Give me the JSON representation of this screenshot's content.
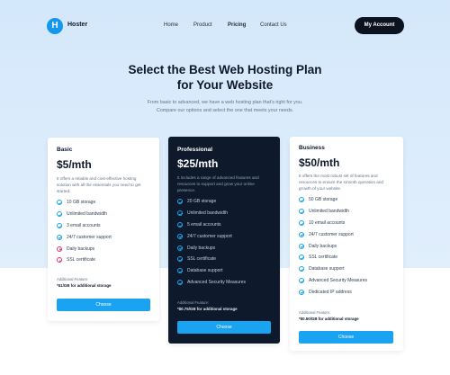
{
  "brand": {
    "logo_letter": "H",
    "name": "Hoster"
  },
  "nav": {
    "links": [
      {
        "label": "Home",
        "active": false
      },
      {
        "label": "Product",
        "active": false
      },
      {
        "label": "Pricing",
        "active": true
      },
      {
        "label": "Contact Us",
        "active": false
      }
    ],
    "account_button": "My Account"
  },
  "hero": {
    "title_line1": "Select the Best Web Hosting Plan",
    "title_line2": "for Your Website",
    "subtitle_line1": "From basic to advanced, we have a web hosting plan that's right for you.",
    "subtitle_line2": "Compare our options and select the one that meets your needs."
  },
  "colors": {
    "accent": "#1aa3f0",
    "hero_bg": "#d4e8fb",
    "dark_card": "#0e1a2b",
    "check": "#1ba3ee",
    "cross": "#e0336b"
  },
  "plans": [
    {
      "name": "Basic",
      "price": "$5/mth",
      "description": "It offers a reliable and cost-effective hosting solution with all the essentials you need to get started.",
      "features": [
        {
          "label": "10 GB storage",
          "icon": "check-circle-icon"
        },
        {
          "label": "Unlimited bandwidth",
          "icon": "check-circle-icon"
        },
        {
          "label": "3 email accounts",
          "icon": "check-circle-icon"
        },
        {
          "label": "24/7 customer support",
          "icon": "check-circle-icon"
        },
        {
          "label": "Daily backups",
          "icon": "cross-circle-icon"
        },
        {
          "label": "SSL certificate",
          "icon": "cross-circle-icon"
        }
      ],
      "additional_label": "Additional Feature:",
      "additional_value": "*$1/GB for additional storage",
      "button": "Choose"
    },
    {
      "name": "Professional",
      "price": "$25/mth",
      "description": "It includes a range of advanced features and resources to support and grow your online presence.",
      "features": [
        {
          "label": "20 GB storage",
          "icon": "check-circle-icon"
        },
        {
          "label": "Unlimited bandwidth",
          "icon": "check-circle-icon"
        },
        {
          "label": "5 email accounts",
          "icon": "check-circle-icon"
        },
        {
          "label": "24/7 customer support",
          "icon": "check-circle-icon"
        },
        {
          "label": "Daily backups",
          "icon": "check-circle-icon"
        },
        {
          "label": "SSL certificate",
          "icon": "check-circle-icon"
        },
        {
          "label": "Database support",
          "icon": "check-circle-icon"
        },
        {
          "label": "Advanced Security Measures",
          "icon": "check-circle-icon"
        }
      ],
      "additional_label": "Additional Feature:",
      "additional_value": "*$0.75/GB for additional storage",
      "button": "Choose"
    },
    {
      "name": "Business",
      "price": "$50/mth",
      "description": "It offers the most robust set of features and resources to ensure the smooth operation and growth of your website.",
      "features": [
        {
          "label": "50 GB storage",
          "icon": "check-circle-icon"
        },
        {
          "label": "Unlimited bandwidth",
          "icon": "check-circle-icon"
        },
        {
          "label": "10 email accounts",
          "icon": "check-circle-icon"
        },
        {
          "label": "24/7 customer support",
          "icon": "check-circle-icon"
        },
        {
          "label": "Daily backups",
          "icon": "check-circle-icon"
        },
        {
          "label": "SSL certificate",
          "icon": "check-circle-icon"
        },
        {
          "label": "Database support",
          "icon": "check-circle-icon"
        },
        {
          "label": "Advanced Security Measures",
          "icon": "check-circle-icon"
        },
        {
          "label": "Dedicated IP address",
          "icon": "check-circle-icon"
        }
      ],
      "additional_label": "Additional Feature:",
      "additional_value": "*$0.50/GB for additional storage",
      "button": "Choose"
    }
  ]
}
